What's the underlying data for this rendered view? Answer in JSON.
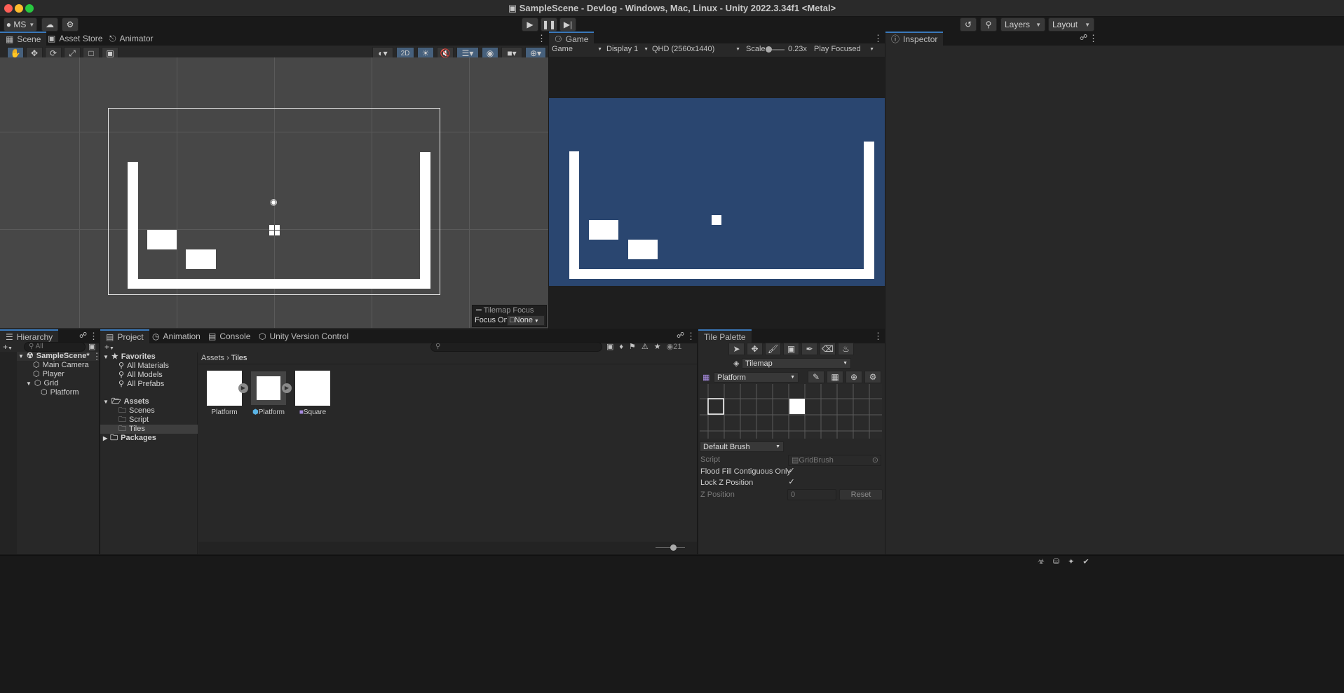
{
  "window": {
    "title": "SampleScene - Devlog - Windows, Mac, Linux - Unity 2022.3.34f1 <Metal>"
  },
  "toolbar": {
    "account": "MS",
    "layers": "Layers",
    "layout": "Layout"
  },
  "scene": {
    "tabs": [
      "Scene",
      "Asset Store",
      "Animator"
    ],
    "mode_2d": "2D",
    "tilemap_focus": {
      "title": "Tilemap Focus",
      "label": "Focus On",
      "value": "None"
    }
  },
  "game": {
    "tab": "Game",
    "view": "Game",
    "display": "Display 1",
    "resolution": "QHD (2560x1440)",
    "scale_label": "Scale",
    "scale_value": "0.23x",
    "play_mode": "Play Focused",
    "background": "#2a4670"
  },
  "inspector": {
    "tab": "Inspector"
  },
  "hierarchy": {
    "tab": "Hierarchy",
    "search_placeholder": "All",
    "items": [
      {
        "label": "SampleScene*"
      },
      {
        "label": "Main Camera"
      },
      {
        "label": "Player"
      },
      {
        "label": "Grid"
      },
      {
        "label": "Platform"
      }
    ]
  },
  "project": {
    "tabs": [
      "Project",
      "Animation",
      "Console",
      "Unity Version Control"
    ],
    "hidden_count": "21",
    "favorites": {
      "label": "Favorites",
      "items": [
        "All Materials",
        "All Models",
        "All Prefabs"
      ]
    },
    "assets": {
      "label": "Assets",
      "items": [
        "Scenes",
        "Script",
        "Tiles"
      ]
    },
    "packages": "Packages",
    "breadcrumb": [
      "Assets",
      "Tiles"
    ],
    "files": [
      "Platform",
      "Platform",
      "Square"
    ]
  },
  "tile_palette": {
    "tab": "Tile Palette",
    "target": "Tilemap",
    "palette": "Platform",
    "brush": "Default Brush",
    "script_label": "Script",
    "script_value": "GridBrush",
    "flood_fill_label": "Flood Fill Contiguous Only",
    "flood_fill": true,
    "lock_z_label": "Lock Z Position",
    "lock_z": true,
    "z_label": "Z Position",
    "z_value": "0",
    "reset": "Reset"
  }
}
